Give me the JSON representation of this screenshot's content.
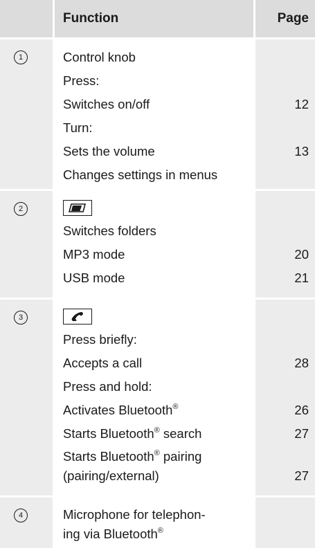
{
  "header": {
    "function": "Function",
    "page": "Page"
  },
  "rows": [
    {
      "number": "1",
      "lines": [
        {
          "text": "Control knob",
          "page": ""
        },
        {
          "text": "Press:",
          "page": ""
        },
        {
          "text": "Switches on/off",
          "page": "12"
        },
        {
          "text": "Turn:",
          "page": ""
        },
        {
          "text": "Sets the volume",
          "page": "13"
        },
        {
          "text": "Changes settings in menus",
          "page": ""
        }
      ]
    },
    {
      "number": "2",
      "key_icon": "folder-key-icon",
      "lines": [
        {
          "text": "Switches folders",
          "page": ""
        },
        {
          "text": "MP3 mode",
          "page": "20"
        },
        {
          "text": "USB mode",
          "page": "21"
        }
      ]
    },
    {
      "number": "3",
      "key_icon": "phone-key-icon",
      "lines": [
        {
          "text": "Press briefly:",
          "page": ""
        },
        {
          "text": "Accepts a call",
          "page": "28"
        },
        {
          "text": "Press and hold:",
          "page": ""
        },
        {
          "text": "Activates Bluetooth",
          "sup": "®",
          "page": "26"
        },
        {
          "text": "Starts Bluetooth",
          "sup": "®",
          "tail": " search",
          "page": "27"
        },
        {
          "text": "Starts Bluetooth",
          "sup": "®",
          "tail": " pairing",
          "page": ""
        },
        {
          "text": "(pairing/external)",
          "page": "27"
        }
      ]
    },
    {
      "number": "4",
      "lines": [
        {
          "text": "Microphone for telephon-",
          "page": ""
        },
        {
          "text": "ing via Bluetooth",
          "sup": "®",
          "page": ""
        }
      ]
    }
  ]
}
